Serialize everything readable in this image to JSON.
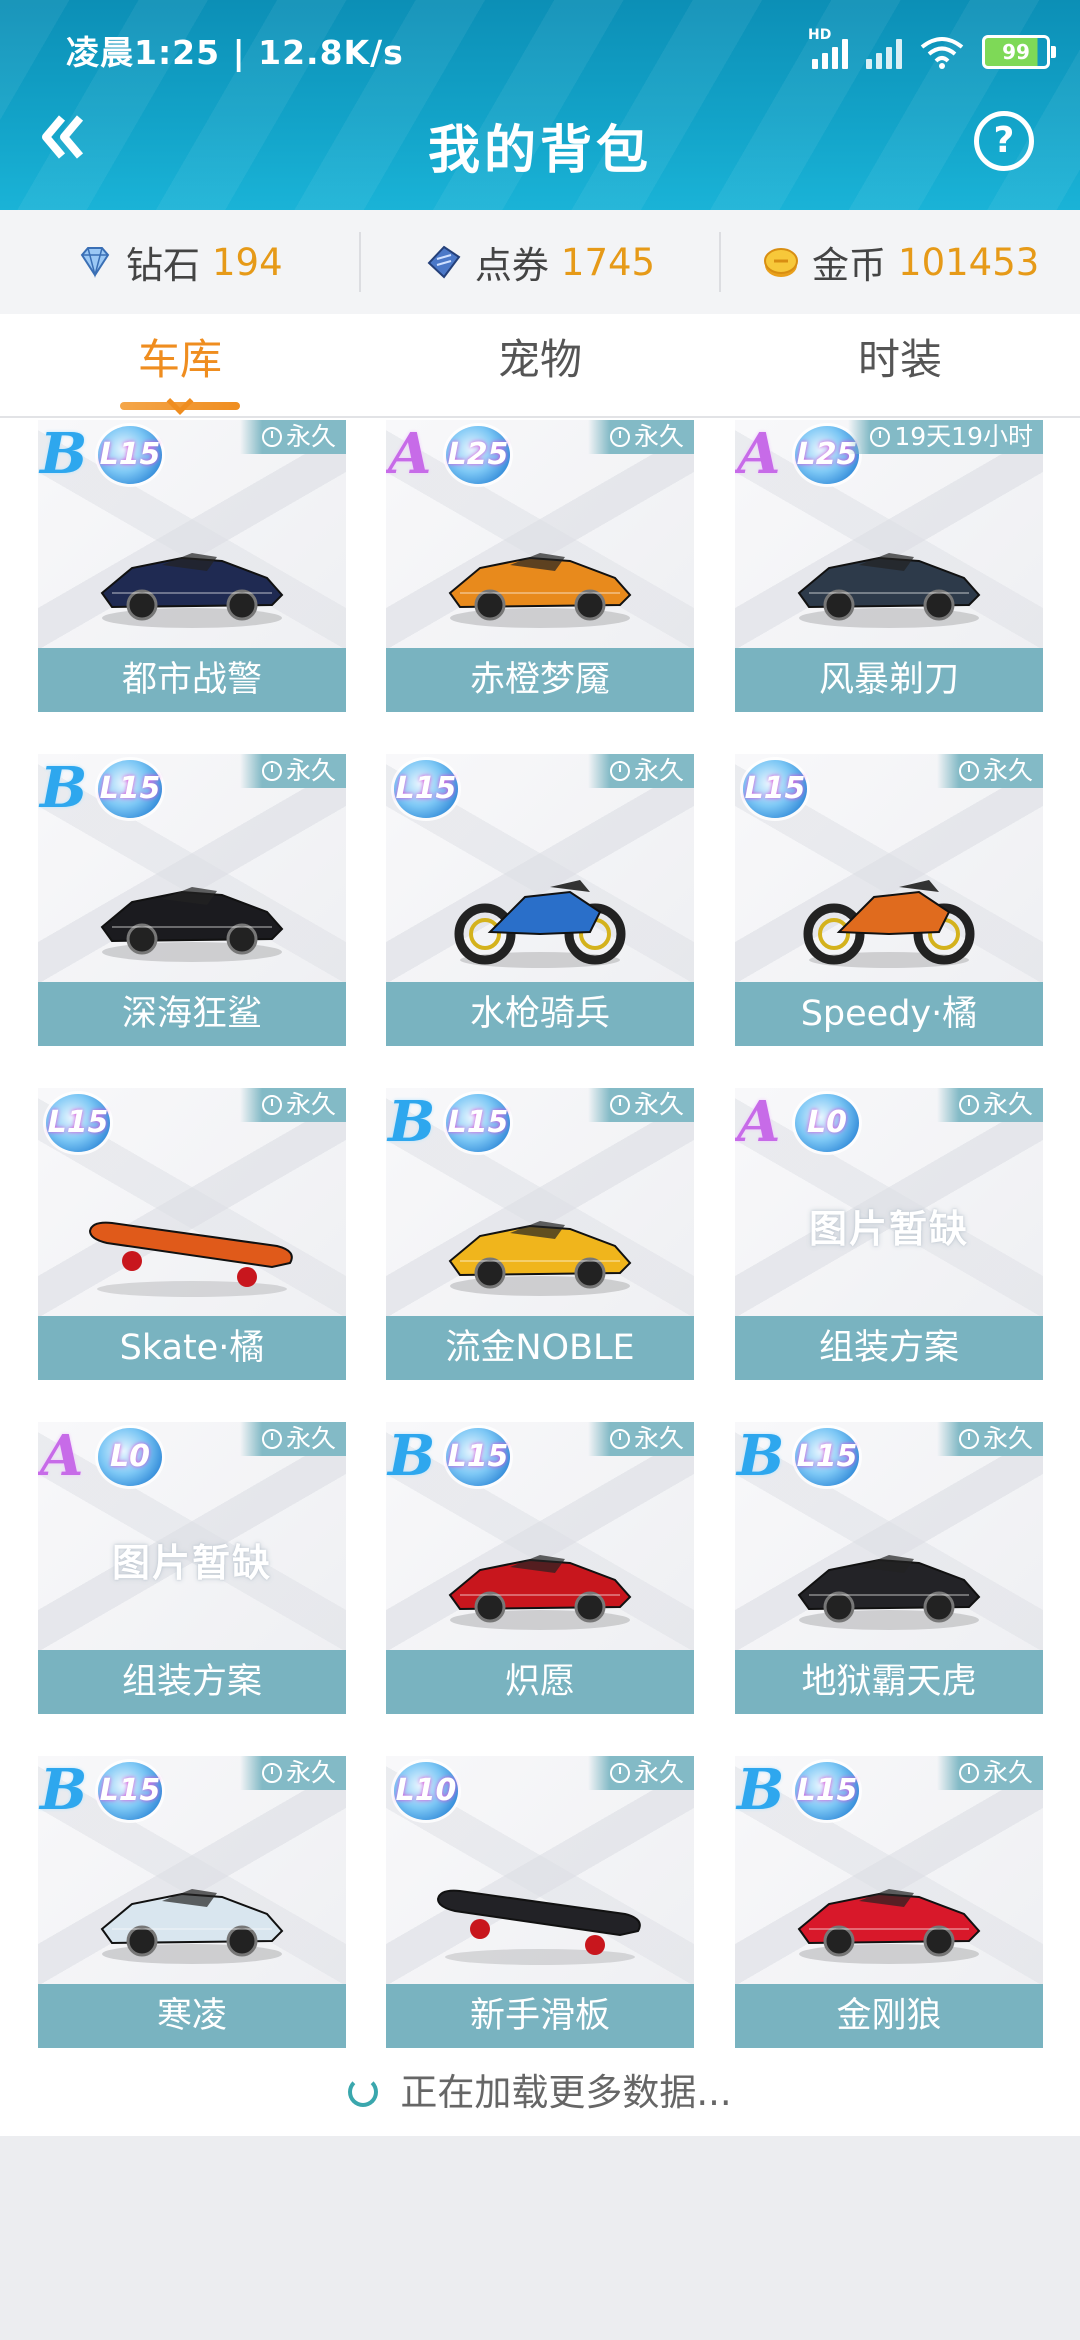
{
  "status_bar": {
    "time": "凌晨1:25 | 12.8K/s",
    "signal_label": "HD",
    "battery": "99"
  },
  "header": {
    "title": "我的背包",
    "help": "?"
  },
  "currency": [
    {
      "label": "钻石",
      "value": "194",
      "icon": "diamond-icon"
    },
    {
      "label": "点券",
      "value": "1745",
      "icon": "coupon-icon"
    },
    {
      "label": "金币",
      "value": "101453",
      "icon": "coin-icon"
    }
  ],
  "tabs": [
    {
      "label": "车库",
      "active": true
    },
    {
      "label": "宠物",
      "active": false
    },
    {
      "label": "时装",
      "active": false
    }
  ],
  "items": [
    {
      "name": "都市战警",
      "rank": "B",
      "level": "15",
      "duration": "永久",
      "image": "car-icon",
      "color": "#1f2a52"
    },
    {
      "name": "赤橙梦魇",
      "rank": "A",
      "level": "25",
      "duration": "永久",
      "image": "car-icon",
      "color": "#e88a1c"
    },
    {
      "name": "风暴剃刀",
      "rank": "A",
      "level": "25",
      "duration": "19天19小时",
      "image": "car-icon",
      "color": "#2d3a4a"
    },
    {
      "name": "深海狂鲨",
      "rank": "B",
      "level": "15",
      "duration": "永久",
      "image": "car-icon",
      "color": "#1b1b1f"
    },
    {
      "name": "水枪骑兵",
      "rank": "",
      "level": "15",
      "duration": "永久",
      "image": "motorcycle-icon",
      "color": "#2a6fc9"
    },
    {
      "name": "Speedy·橘",
      "rank": "",
      "level": "15",
      "duration": "永久",
      "image": "motorcycle-icon",
      "color": "#e06b1e"
    },
    {
      "name": "Skate·橘",
      "rank": "",
      "level": "15",
      "duration": "永久",
      "image": "skateboard-icon",
      "color": "#e05a1a"
    },
    {
      "name": "流金NOBLE",
      "rank": "B",
      "level": "15",
      "duration": "永久",
      "image": "car-icon",
      "color": "#f0b51c"
    },
    {
      "name": "组装方案",
      "rank": "A",
      "level": "0",
      "duration": "永久",
      "image": "no-image",
      "no_image_text": "图片暂缺",
      "color": "#cccccc"
    },
    {
      "name": "组装方案",
      "rank": "A",
      "level": "0",
      "duration": "永久",
      "image": "no-image",
      "no_image_text": "图片暂缺",
      "color": "#cccccc"
    },
    {
      "name": "炽愿",
      "rank": "B",
      "level": "15",
      "duration": "永久",
      "image": "car-icon",
      "color": "#c8161d"
    },
    {
      "name": "地狱霸天虎",
      "rank": "B",
      "level": "15",
      "duration": "永久",
      "image": "car-icon",
      "color": "#232327"
    },
    {
      "name": "寒凌",
      "rank": "B",
      "level": "15",
      "duration": "永久",
      "image": "car-icon",
      "color": "#d9e6ef"
    },
    {
      "name": "新手滑板",
      "rank": "",
      "level": "10",
      "duration": "永久",
      "image": "skateboard-icon",
      "color": "#222226"
    },
    {
      "name": "金刚狼",
      "rank": "B",
      "level": "15",
      "duration": "永久",
      "image": "car-icon",
      "color": "#d8182a"
    }
  ],
  "loading_text": "正在加载更多数据..."
}
